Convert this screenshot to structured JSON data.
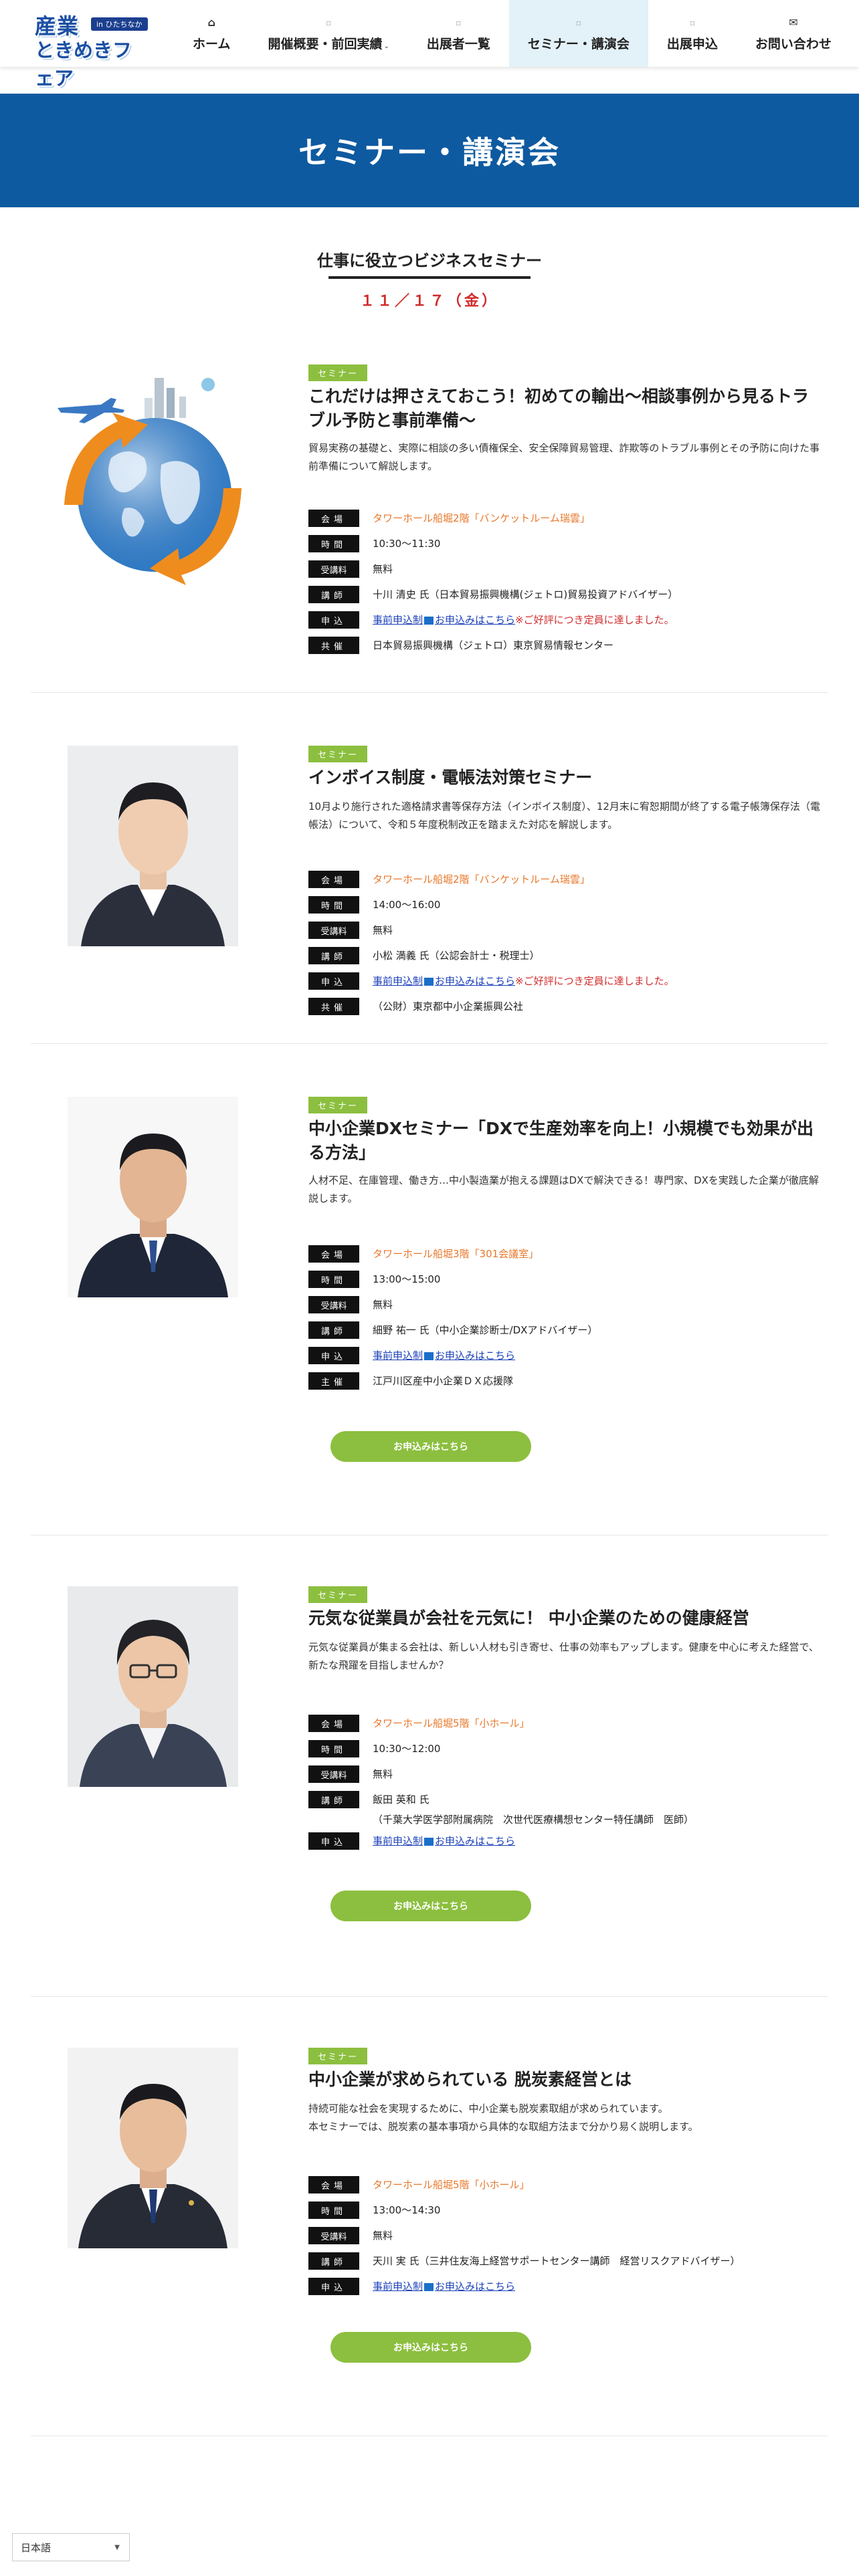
{
  "header": {
    "logo": {
      "badge": "in ひたちなか",
      "line1": "産業",
      "line2": "ときめきフェア"
    },
    "nav": [
      {
        "label": "ホーム",
        "icon": "home-icon",
        "glyph": "⌂"
      },
      {
        "label": "開催概要・前回実績",
        "icon": "dot-icon",
        "glyph": "▫",
        "caret": "⌄"
      },
      {
        "label": "出展者一覧",
        "icon": "dot-icon",
        "glyph": "▫"
      },
      {
        "label": "セミナー・講演会",
        "icon": "dot-icon",
        "glyph": "▫",
        "active": true
      },
      {
        "label": "出展申込",
        "icon": "dot-icon",
        "glyph": "▫"
      },
      {
        "label": "お問い合わせ",
        "icon": "envelope-icon",
        "glyph": "✉"
      }
    ]
  },
  "hero": {
    "title": "セミナー・講演会"
  },
  "section": {
    "title": "仕事に役立つビジネスセミナー",
    "date": "１１／１７（金）"
  },
  "labels": {
    "venue": "会場",
    "time": "時間",
    "fee": "受講料",
    "speaker": "講師",
    "apply": "申込",
    "organizer": "共催",
    "host": "主催"
  },
  "seminars": [
    {
      "tag": "セミナー",
      "title": "これだけは押さえておこう！初めての輸出～相談事例から見るトラブル予防と事前準備～",
      "desc": "貿易実務の基礎と、実際に相談の多い債権保全、安全保障貿易管理、詐欺等のトラブル事例とその予防に向けた事前準備について解説します。",
      "venue": "タワーホール船堀2階「バンケットルーム瑞雲」",
      "time": "10:30～11:30",
      "fee": "無料",
      "speaker": "十川 清史 氏（日本貿易振興機構(ジェトロ)貿易投資アドバイザー）",
      "apply_link": "事前申込制",
      "apply_link2": "お申込みはこちら",
      "apply_note": "※ご好評につき定員に達しました。",
      "org_label": "共催",
      "organizer": "日本貿易振興機構（ジェトロ）東京貿易情報センター"
    },
    {
      "tag": "セミナー",
      "title": "インボイス制度・電帳法対策セミナー",
      "desc": "10月より施行された適格請求書等保存方法（インボイス制度）、12月末に宥恕期間が終了する電子帳簿保存法（電帳法）について、令和５年度税制改正を踏まえた対応を解説します。",
      "venue": "タワーホール船堀2階「バンケットルーム瑞雲」",
      "time": "14:00～16:00",
      "fee": "無料",
      "speaker": "小松 満義 氏（公認会計士・税理士）",
      "apply_link": "事前申込制",
      "apply_link2": "お申込みはこちら",
      "apply_note": "※ご好評につき定員に達しました。",
      "org_label": "共催",
      "organizer": "（公財）東京都中小企業振興公社"
    },
    {
      "tag": "セミナー",
      "title": "中小企業DXセミナー「DXで生産効率を向上！小規模でも効果が出る方法」",
      "desc": "人材不足、在庫管理、働き方…中小製造業が抱える課題はDXで解決できる！専門家、DXを実践した企業が徹底解説します。",
      "venue": "タワーホール船堀3階「301会議室」",
      "time": "13:00～15:00",
      "fee": "無料",
      "speaker": "細野 祐一 氏（中小企業診断士/DXアドバイザー）",
      "apply_link": "事前申込制",
      "apply_link2": "お申込みはこちら",
      "org_label": "主催",
      "organizer": "江戸川区産中小企業ＤＸ応援隊",
      "button": "お申込みはこちら"
    },
    {
      "tag": "セミナー",
      "title": "元気な従業員が会社を元気に！ 中小企業のための健康経営",
      "desc": "元気な従業員が集まる会社は、新しい人材も引き寄せ、仕事の効率もアップします。健康を中心に考えた経営で、新たな飛躍を目指しませんか？",
      "venue": "タワーホール船堀5階「小ホール」",
      "time": "10:30～12:00",
      "fee": "無料",
      "speaker": "飯田 英和 氏",
      "speaker2": "（千葉大学医学部附属病院　次世代医療構想センター特任講師　医師）",
      "apply_link": "事前申込制",
      "apply_link2": "お申込みはこちら",
      "button": "お申込みはこちら"
    },
    {
      "tag": "セミナー",
      "title": "中小企業が求められている 脱炭素経営とは",
      "desc": "持続可能な社会を実現するために、中小企業も脱炭素取組が求められています。",
      "desc2": "本セミナーでは、脱炭素の基本事項から具体的な取組方法まで分かり易く説明します。",
      "venue": "タワーホール船堀5階「小ホール」",
      "time": "13:00～14:30",
      "fee": "無料",
      "speaker": "天川 実 氏（三井住友海上経営サポートセンター講師　経営リスクアドバイザー）",
      "apply_link": "事前申込制",
      "apply_link2": "お申込みはこちら",
      "button": "お申込みはこちら"
    }
  ],
  "language": {
    "selected": "日本語"
  },
  "colors": {
    "brand_blue": "#0e5aa0",
    "green": "#8cbf3f",
    "venue_orange": "#e8772a",
    "alert_red": "#d22b2b",
    "link_blue": "#1a3fb8"
  }
}
